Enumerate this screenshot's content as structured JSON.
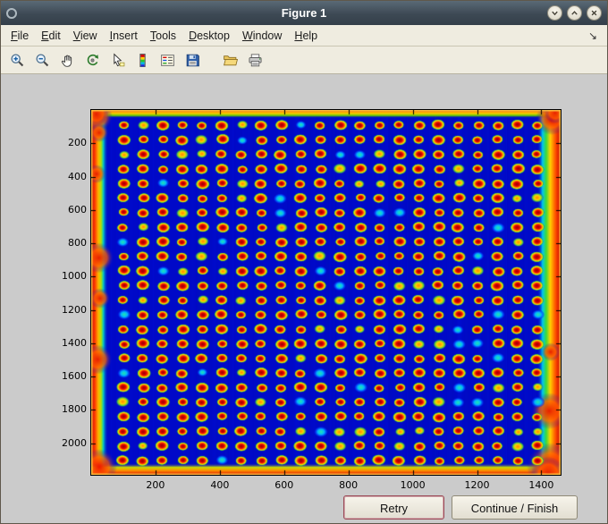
{
  "window": {
    "title": "Figure 1",
    "controls": [
      {
        "name": "minimize"
      },
      {
        "name": "maximize"
      },
      {
        "name": "close"
      }
    ]
  },
  "menubar": {
    "items": [
      {
        "label": "File"
      },
      {
        "label": "Edit"
      },
      {
        "label": "View"
      },
      {
        "label": "Insert"
      },
      {
        "label": "Tools"
      },
      {
        "label": "Desktop"
      },
      {
        "label": "Window"
      },
      {
        "label": "Help"
      }
    ],
    "dock_arrow": "↘"
  },
  "toolbar": {
    "buttons": [
      {
        "name": "zoom-in"
      },
      {
        "name": "zoom-out"
      },
      {
        "name": "pan"
      },
      {
        "name": "rotate-3d"
      },
      {
        "name": "data-cursor"
      },
      {
        "name": "insert-colorbar"
      },
      {
        "name": "insert-legend"
      },
      {
        "name": "save"
      },
      {
        "name": "open"
      },
      {
        "name": "print"
      }
    ]
  },
  "actions": {
    "retry": "Retry",
    "continue": "Continue / Finish"
  },
  "chart_data": {
    "type": "heatmap",
    "title": "",
    "xlabel": "",
    "ylabel": "",
    "description": "Microarray slide scan displayed with jet colormap: ~22 x 24 grid of spots with dark-red/orange centers and yellow-green halos on a deep blue background; saturated red-orange bands along all four image edges (strongest at left, right and bottom-right corner).",
    "colormap": "jet",
    "x_ticks": [
      200,
      400,
      600,
      800,
      1000,
      1200,
      1400
    ],
    "y_ticks": [
      200,
      400,
      600,
      800,
      1000,
      1200,
      1400,
      1600,
      1800,
      2000
    ],
    "x_range": [
      0,
      1460
    ],
    "y_range": [
      0,
      2190
    ],
    "spot_grid": {
      "rows": 24,
      "cols": 22
    },
    "colors": {
      "background": "#0009c8",
      "spot_center": "#a00000",
      "spot_mid": "#e60000",
      "halo_yellow": "#ffe000",
      "halo_green": "#3cc83c",
      "edge_hot": "#c80000",
      "edge_warm": "#ffb400",
      "cool_cyan": "#00c8c8",
      "figure_gray": "#cbcbcb"
    }
  }
}
